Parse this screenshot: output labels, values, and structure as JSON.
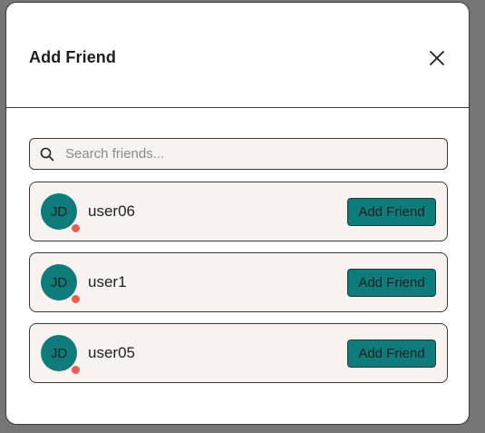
{
  "modal": {
    "title": "Add Friend"
  },
  "search": {
    "placeholder": "Search friends..."
  },
  "friends": [
    {
      "initials": "JD",
      "username": "user06",
      "action_label": "Add Friend"
    },
    {
      "initials": "JD",
      "username": "user1",
      "action_label": "Add Friend"
    },
    {
      "initials": "JD",
      "username": "user05",
      "action_label": "Add Friend"
    }
  ],
  "icons": {
    "close": "close-icon",
    "search": "search-icon"
  },
  "colors": {
    "accent": "#0e7c7b",
    "status_offline": "#ef5b4f",
    "card_background": "#f8f3f0",
    "overlay": "#757575"
  }
}
